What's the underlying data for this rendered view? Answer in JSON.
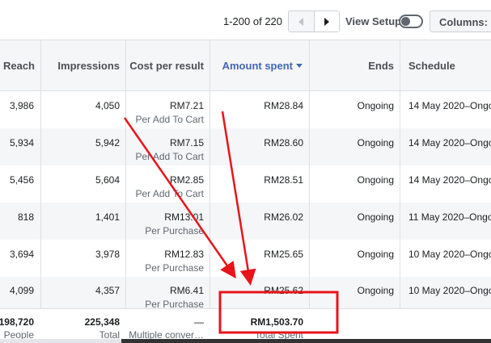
{
  "toolbar": {
    "pagination_text": "1-200 of 220",
    "view_setup_label": "View Setup",
    "columns_label": "Columns: C"
  },
  "columns": {
    "reach": "Reach",
    "impressions": "Impressions",
    "cost_per_result": "Cost per result",
    "amount_spent": "Amount spent",
    "ends": "Ends",
    "schedule": "Schedule"
  },
  "rows": [
    {
      "reach": "3,986",
      "impressions": "4,050",
      "cost": "RM7.21",
      "cost_sub": "Per Add To Cart",
      "spent": "RM28.84",
      "ends": "Ongoing",
      "schedule": "14 May 2020–Ongo"
    },
    {
      "reach": "5,934",
      "impressions": "5,942",
      "cost": "RM7.15",
      "cost_sub": "Per Add To Cart",
      "spent": "RM28.60",
      "ends": "Ongoing",
      "schedule": "14 May 2020–Ongo"
    },
    {
      "reach": "5,456",
      "impressions": "5,604",
      "cost": "RM2.85",
      "cost_sub": "Per Add To Cart",
      "spent": "RM28.51",
      "ends": "Ongoing",
      "schedule": "14 May 2020–Ongo"
    },
    {
      "reach": "818",
      "impressions": "1,401",
      "cost": "RM13.01",
      "cost_sub": "Per Purchase",
      "spent": "RM26.02",
      "ends": "Ongoing",
      "schedule": "11 May 2020–Ongo"
    },
    {
      "reach": "3,694",
      "impressions": "3,978",
      "cost": "RM12.83",
      "cost_sub": "Per Purchase",
      "spent": "RM25.65",
      "ends": "Ongoing",
      "schedule": "10 May 2020–Ongo"
    },
    {
      "reach": "4,099",
      "impressions": "4,357",
      "cost": "RM6.41",
      "cost_sub": "Per Purchase",
      "spent": "RM25.62",
      "ends": "Ongoing",
      "schedule": "10 May 2020–Ongo"
    }
  ],
  "totals": {
    "reach": "198,720",
    "reach_sub": "People",
    "impressions": "225,348",
    "impressions_sub": "Total",
    "cost": "—",
    "cost_sub": "Multiple conver…",
    "spent": "RM1,503.70",
    "spent_sub": "Total Spent"
  },
  "colors": {
    "annotation": "#e8141b",
    "accent": "#4267b2"
  }
}
